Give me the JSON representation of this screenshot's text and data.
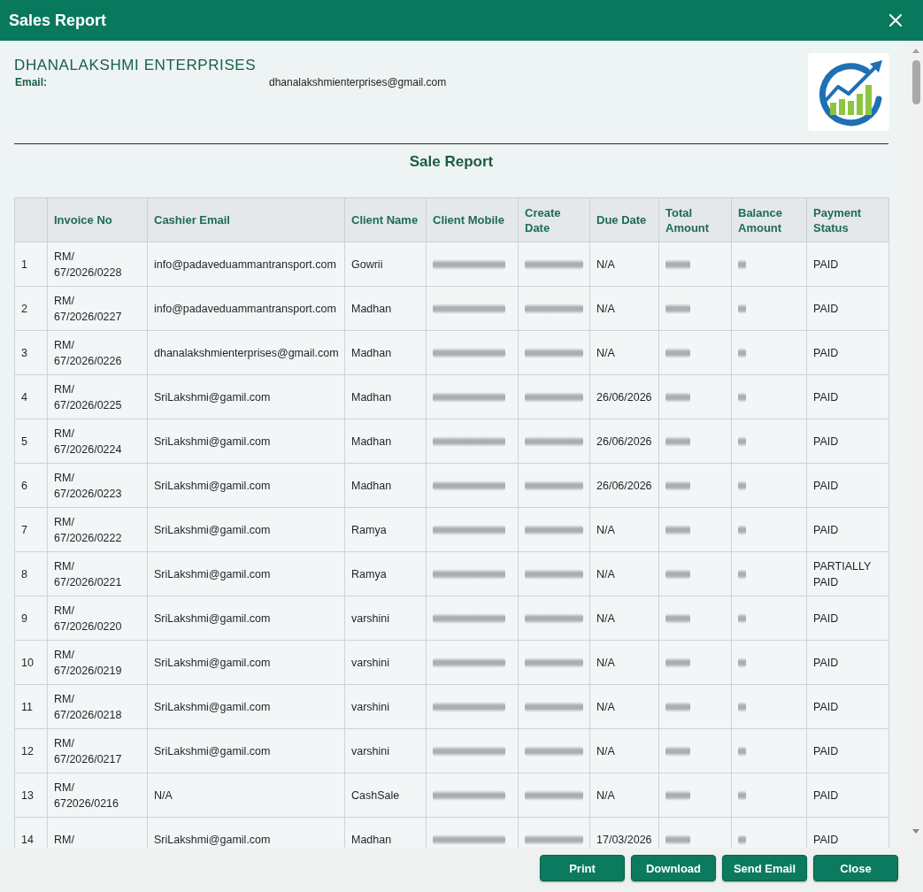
{
  "window": {
    "title": "Sales Report"
  },
  "company": {
    "name": "DHANALAKSHMI ENTERPRISES",
    "email_label": "Email:",
    "email": "dhanalakshmienterprises@gmail.com"
  },
  "report_title": "Sale Report",
  "table": {
    "columns": [
      "",
      "Invoice No",
      "Cashier Email",
      "Client Name",
      "Client Mobile",
      "Create Date",
      "Due Date",
      "Total Amount",
      "Balance Amount",
      "Payment Status"
    ],
    "rows": [
      {
        "cells": [
          {
            "kind": "text",
            "text": "1"
          },
          {
            "kind": "text",
            "text": "RM/\n67/2026/0228"
          },
          {
            "kind": "text",
            "text": "info@padaveduammantransport.com"
          },
          {
            "kind": "text",
            "text": "Gowrii"
          },
          {
            "kind": "redacted"
          },
          {
            "kind": "redacted"
          },
          {
            "kind": "text",
            "text": "N/A"
          },
          {
            "kind": "redacted"
          },
          {
            "kind": "redacted"
          },
          {
            "kind": "text",
            "text": "PAID"
          }
        ]
      },
      {
        "cells": [
          {
            "kind": "text",
            "text": "2"
          },
          {
            "kind": "text",
            "text": "RM/\n67/2026/0227"
          },
          {
            "kind": "text",
            "text": "info@padaveduammantransport.com"
          },
          {
            "kind": "text",
            "text": "Madhan"
          },
          {
            "kind": "redacted"
          },
          {
            "kind": "redacted"
          },
          {
            "kind": "text",
            "text": "N/A"
          },
          {
            "kind": "redacted"
          },
          {
            "kind": "redacted"
          },
          {
            "kind": "text",
            "text": "PAID"
          }
        ]
      },
      {
        "cells": [
          {
            "kind": "text",
            "text": "3"
          },
          {
            "kind": "text",
            "text": "RM/\n67/2026/0226"
          },
          {
            "kind": "text",
            "text": "dhanalakshmienterprises@gmail.com"
          },
          {
            "kind": "text",
            "text": "Madhan"
          },
          {
            "kind": "redacted"
          },
          {
            "kind": "redacted"
          },
          {
            "kind": "text",
            "text": "N/A"
          },
          {
            "kind": "redacted"
          },
          {
            "kind": "redacted"
          },
          {
            "kind": "text",
            "text": "PAID"
          }
        ]
      },
      {
        "cells": [
          {
            "kind": "text",
            "text": "4"
          },
          {
            "kind": "text",
            "text": "RM/\n67/2026/0225"
          },
          {
            "kind": "text",
            "text": "SriLakshmi@gamil.com"
          },
          {
            "kind": "text",
            "text": "Madhan"
          },
          {
            "kind": "redacted"
          },
          {
            "kind": "redacted"
          },
          {
            "kind": "text",
            "text": "26/06/2026"
          },
          {
            "kind": "redacted"
          },
          {
            "kind": "redacted"
          },
          {
            "kind": "text",
            "text": "PAID"
          }
        ]
      },
      {
        "cells": [
          {
            "kind": "text",
            "text": "5"
          },
          {
            "kind": "text",
            "text": "RM/\n67/2026/0224"
          },
          {
            "kind": "text",
            "text": "SriLakshmi@gamil.com"
          },
          {
            "kind": "text",
            "text": "Madhan"
          },
          {
            "kind": "redacted"
          },
          {
            "kind": "redacted"
          },
          {
            "kind": "text",
            "text": "26/06/2026"
          },
          {
            "kind": "redacted"
          },
          {
            "kind": "redacted"
          },
          {
            "kind": "text",
            "text": "PAID"
          }
        ]
      },
      {
        "cells": [
          {
            "kind": "text",
            "text": "6"
          },
          {
            "kind": "text",
            "text": "RM/\n67/2026/0223"
          },
          {
            "kind": "text",
            "text": "SriLakshmi@gamil.com"
          },
          {
            "kind": "text",
            "text": "Madhan"
          },
          {
            "kind": "redacted"
          },
          {
            "kind": "redacted"
          },
          {
            "kind": "text",
            "text": "26/06/2026"
          },
          {
            "kind": "redacted"
          },
          {
            "kind": "redacted"
          },
          {
            "kind": "text",
            "text": "PAID"
          }
        ]
      },
      {
        "cells": [
          {
            "kind": "text",
            "text": "7"
          },
          {
            "kind": "text",
            "text": "RM/\n67/2026/0222"
          },
          {
            "kind": "text",
            "text": "SriLakshmi@gamil.com"
          },
          {
            "kind": "text",
            "text": "Ramya"
          },
          {
            "kind": "redacted"
          },
          {
            "kind": "redacted"
          },
          {
            "kind": "text",
            "text": "N/A"
          },
          {
            "kind": "redacted"
          },
          {
            "kind": "redacted"
          },
          {
            "kind": "text",
            "text": "PAID"
          }
        ]
      },
      {
        "cells": [
          {
            "kind": "text",
            "text": "8"
          },
          {
            "kind": "text",
            "text": "RM/\n67/2026/0221"
          },
          {
            "kind": "text",
            "text": "SriLakshmi@gamil.com"
          },
          {
            "kind": "text",
            "text": "Ramya"
          },
          {
            "kind": "redacted"
          },
          {
            "kind": "redacted"
          },
          {
            "kind": "text",
            "text": "N/A"
          },
          {
            "kind": "redacted"
          },
          {
            "kind": "redacted"
          },
          {
            "kind": "text",
            "text": "PARTIALLY PAID"
          }
        ]
      },
      {
        "cells": [
          {
            "kind": "text",
            "text": "9"
          },
          {
            "kind": "text",
            "text": "RM/\n67/2026/0220"
          },
          {
            "kind": "text",
            "text": "SriLakshmi@gamil.com"
          },
          {
            "kind": "text",
            "text": "varshini"
          },
          {
            "kind": "redacted"
          },
          {
            "kind": "redacted"
          },
          {
            "kind": "text",
            "text": "N/A"
          },
          {
            "kind": "redacted"
          },
          {
            "kind": "redacted"
          },
          {
            "kind": "text",
            "text": "PAID"
          }
        ]
      },
      {
        "cells": [
          {
            "kind": "text",
            "text": "10"
          },
          {
            "kind": "text",
            "text": "RM/\n67/2026/0219"
          },
          {
            "kind": "text",
            "text": "SriLakshmi@gamil.com"
          },
          {
            "kind": "text",
            "text": "varshini"
          },
          {
            "kind": "redacted"
          },
          {
            "kind": "redacted"
          },
          {
            "kind": "text",
            "text": "N/A"
          },
          {
            "kind": "redacted"
          },
          {
            "kind": "redacted"
          },
          {
            "kind": "text",
            "text": "PAID"
          }
        ]
      },
      {
        "cells": [
          {
            "kind": "text",
            "text": "11"
          },
          {
            "kind": "text",
            "text": "RM/\n67/2026/0218"
          },
          {
            "kind": "text",
            "text": "SriLakshmi@gamil.com"
          },
          {
            "kind": "text",
            "text": "varshini"
          },
          {
            "kind": "redacted"
          },
          {
            "kind": "redacted"
          },
          {
            "kind": "text",
            "text": "N/A"
          },
          {
            "kind": "redacted"
          },
          {
            "kind": "redacted"
          },
          {
            "kind": "text",
            "text": "PAID"
          }
        ]
      },
      {
        "cells": [
          {
            "kind": "text",
            "text": "12"
          },
          {
            "kind": "text",
            "text": "RM/\n67/2026/0217"
          },
          {
            "kind": "text",
            "text": "SriLakshmi@gamil.com"
          },
          {
            "kind": "text",
            "text": "varshini"
          },
          {
            "kind": "redacted"
          },
          {
            "kind": "redacted"
          },
          {
            "kind": "text",
            "text": "N/A"
          },
          {
            "kind": "redacted"
          },
          {
            "kind": "redacted"
          },
          {
            "kind": "text",
            "text": "PAID"
          }
        ]
      },
      {
        "cells": [
          {
            "kind": "text",
            "text": "13"
          },
          {
            "kind": "text",
            "text": "RM/\n672026/0216"
          },
          {
            "kind": "text",
            "text": "N/A"
          },
          {
            "kind": "text",
            "text": "CashSale"
          },
          {
            "kind": "redacted"
          },
          {
            "kind": "redacted"
          },
          {
            "kind": "text",
            "text": "N/A"
          },
          {
            "kind": "redacted"
          },
          {
            "kind": "redacted"
          },
          {
            "kind": "text",
            "text": "PAID"
          }
        ]
      },
      {
        "cells": [
          {
            "kind": "text",
            "text": "14"
          },
          {
            "kind": "text",
            "text": "RM/"
          },
          {
            "kind": "text",
            "text": "SriLakshmi@gamil.com"
          },
          {
            "kind": "text",
            "text": "Madhan"
          },
          {
            "kind": "redacted"
          },
          {
            "kind": "redacted"
          },
          {
            "kind": "text",
            "text": "17/03/2026"
          },
          {
            "kind": "redacted"
          },
          {
            "kind": "redacted"
          },
          {
            "kind": "text",
            "text": "PAID"
          }
        ]
      }
    ]
  },
  "buttons": [
    "Print",
    "Download",
    "Send Email",
    "Close"
  ]
}
